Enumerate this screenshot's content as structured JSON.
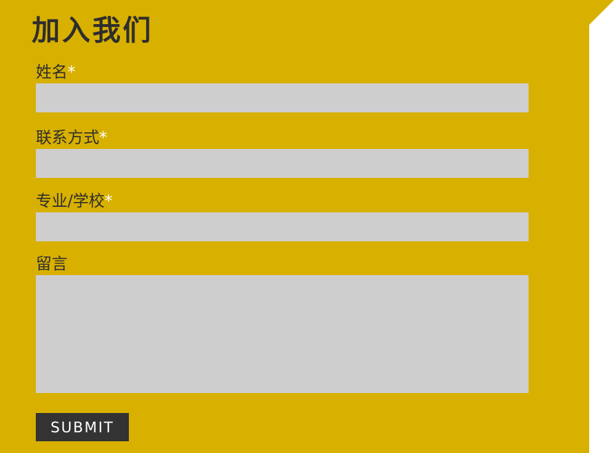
{
  "form": {
    "title": "加入我们",
    "required_marker": "*",
    "fields": [
      {
        "label": "姓名",
        "required": true,
        "value": ""
      },
      {
        "label": "联系方式",
        "required": true,
        "value": ""
      },
      {
        "label": "专业/学校",
        "required": true,
        "value": ""
      },
      {
        "label": "留言",
        "required": false,
        "value": ""
      }
    ],
    "submit_label": "SUBMIT"
  },
  "colors": {
    "panel_background": "#d8b000",
    "field_background": "#cecece",
    "text": "#2e2e2e",
    "required_marker": "#ffffff",
    "button_background": "#333333",
    "button_text": "#ffffff"
  }
}
